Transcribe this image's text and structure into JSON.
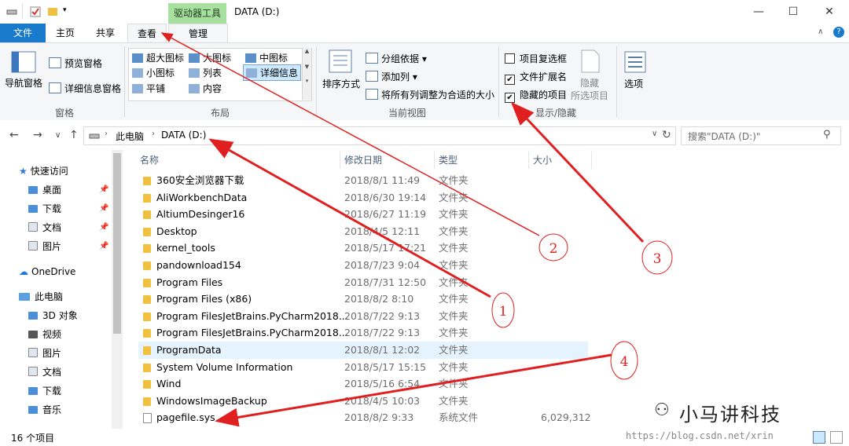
{
  "window": {
    "title": "DATA (D:)",
    "context_tab_label": "驱动器工具",
    "controls": {
      "minimize": "—",
      "maximize": "☐",
      "close": "✕"
    }
  },
  "tabs": [
    {
      "label": "文件"
    },
    {
      "label": "主页"
    },
    {
      "label": "共享"
    },
    {
      "label": "查看"
    },
    {
      "label": "管理"
    }
  ],
  "ribbon": {
    "panes": {
      "nav_pane_label": "导航窗格",
      "preview_pane_label": "预览窗格",
      "details_pane_label": "详细信息窗格",
      "group_label": "窗格"
    },
    "layout": {
      "options": [
        "超大图标",
        "大图标",
        "中图标",
        "小图标",
        "列表",
        "详细信息",
        "平铺",
        "内容"
      ],
      "group_label": "布局"
    },
    "current_view": {
      "sort_label": "排序方式",
      "group_by": "分组依据",
      "add_column": "添加列",
      "fit_columns": "将所有列调整为合适的大小",
      "group_label": "当前视图"
    },
    "show_hide": {
      "item_checkboxes": "项目复选框",
      "file_extensions": "文件扩展名",
      "hidden_items": "隐藏的项目",
      "hide_selected_1": "隐藏",
      "hide_selected_2": "所选项目",
      "group_label": "显示/隐藏",
      "checked": {
        "item_checkboxes": false,
        "file_extensions": true,
        "hidden_items": true
      }
    },
    "options_label": "选项"
  },
  "address": {
    "crumbs": [
      "此电脑",
      "DATA (D:)"
    ],
    "search_placeholder": "搜索\"DATA (D:)\""
  },
  "nav": {
    "quick_access": "快速访问",
    "quick_items": [
      "桌面",
      "下载",
      "文档",
      "图片"
    ],
    "onedrive": "OneDrive",
    "this_pc": "此电脑",
    "pc_items": [
      "3D 对象",
      "视频",
      "图片",
      "文档",
      "下载",
      "音乐"
    ]
  },
  "columns": {
    "name": "名称",
    "date": "修改日期",
    "type": "类型",
    "size": "大小"
  },
  "files": [
    {
      "name": "360安全浏览器下载",
      "date": "2018/8/1 11:49",
      "type": "文件夹",
      "size": ""
    },
    {
      "name": "AliWorkbenchData",
      "date": "2018/6/30 19:14",
      "type": "文件夹",
      "size": ""
    },
    {
      "name": "AltiumDesinger16",
      "date": "2018/6/27 11:19",
      "type": "文件夹",
      "size": ""
    },
    {
      "name": "Desktop",
      "date": "2018/4/5 12:11",
      "type": "文件夹",
      "size": ""
    },
    {
      "name": "kernel_tools",
      "date": "2018/5/17 17:21",
      "type": "文件夹",
      "size": ""
    },
    {
      "name": "pandownload154",
      "date": "2018/7/23 9:04",
      "type": "文件夹",
      "size": ""
    },
    {
      "name": "Program Files",
      "date": "2018/7/31 12:50",
      "type": "文件夹",
      "size": ""
    },
    {
      "name": "Program Files (x86)",
      "date": "2018/8/2 8:10",
      "type": "文件夹",
      "size": ""
    },
    {
      "name": "Program FilesJetBrains.PyCharm2018...",
      "date": "2018/7/22 9:13",
      "type": "文件夹",
      "size": ""
    },
    {
      "name": "Program FilesJetBrains.PyCharm2018...",
      "date": "2018/7/22 9:13",
      "type": "文件夹",
      "size": ""
    },
    {
      "name": "ProgramData",
      "date": "2018/8/1 12:02",
      "type": "文件夹",
      "size": ""
    },
    {
      "name": "System Volume Information",
      "date": "2018/5/17 15:15",
      "type": "文件夹",
      "size": ""
    },
    {
      "name": "Wind",
      "date": "2018/5/16 6:54",
      "type": "文件夹",
      "size": ""
    },
    {
      "name": "WindowsImageBackup",
      "date": "2018/4/5 10:03",
      "type": "文件夹",
      "size": ""
    },
    {
      "name": "pagefile.sys",
      "date": "2018/8/2 9:33",
      "type": "系统文件",
      "size": "6,029,312"
    }
  ],
  "status": {
    "count": "16 个项目"
  },
  "annotations": {
    "markers": [
      "1",
      "2",
      "3",
      "4"
    ],
    "watermark": "小马讲科技",
    "url": "https://blog.csdn.net/xrin"
  },
  "colors": {
    "file_tab": "#1979ca",
    "context_tab": "#a8e0a0",
    "arrow": "#e02020",
    "selection": "#e5f3ff"
  }
}
